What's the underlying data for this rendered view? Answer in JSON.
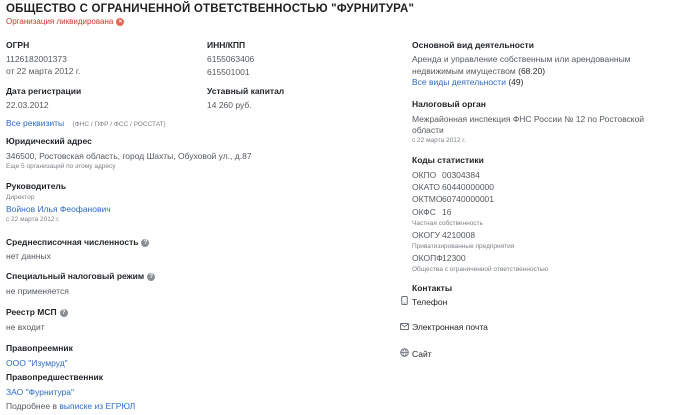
{
  "header": {
    "company_title": "ОБЩЕСТВО С ОГРАНИЧЕННОЙ ОТВЕТСТВЕННОСТЬЮ \"ФУРНИТУРА\"",
    "status_text": "Организация ликвидирована",
    "status_icon": "close-circle-icon"
  },
  "ogrn": {
    "label": "ОГРН",
    "value": "1126182001373",
    "date": "от 22 марта 2012 г."
  },
  "inn_kpp": {
    "label": "ИНН/КПП",
    "inn": "6155063406",
    "kpp": "615501001"
  },
  "registration": {
    "label": "Дата регистрации",
    "value": "22.03.2012"
  },
  "capital": {
    "label": "Уставный капитал",
    "value": "14 260 руб."
  },
  "requisites": {
    "link": "Все реквизиты",
    "sources": "(ФНС / ПФР / ФСС / РОССТАТ)"
  },
  "address": {
    "label": "Юридический адрес",
    "value": "346500, Ростовская область, город Шахты, Обуховой ул., д.87",
    "note": "Еще 5 организаций по этому адресу"
  },
  "director": {
    "label": "Руководитель",
    "role": "Директор",
    "name": "Войнов Илья Феофанович",
    "date": "с 22 марта 2012 г."
  },
  "headcount": {
    "label": "Среднесписочная численность",
    "value": "нет данных"
  },
  "tax_regime": {
    "label": "Специальный налоговый режим",
    "value": "не применяется"
  },
  "msp": {
    "label": "Реестр МСП",
    "value": "не входит"
  },
  "successor": {
    "label": "Правопреемник",
    "value": "ООО \"Изумруд\""
  },
  "predecessor": {
    "label": "Правопредшественник",
    "value": "ЗАО \"Фурнитура\"",
    "more_prefix": "Подробнее в",
    "more_link": "выписке из ЕГРЮЛ"
  },
  "activity": {
    "label": "Основной вид деятельности",
    "line1": "Аренда и управление собственным или арендованным",
    "line2_text": "недвижимым имуществом",
    "line2_code": "(68.20)",
    "all_link": "Все виды деятельности",
    "all_count": "(49)"
  },
  "tax_authority": {
    "label": "Налоговый орган",
    "line1": "Межрайонная инспекция ФНС России № 12 по Ростовской",
    "line2": "области",
    "date": "с 22 марта 2012 г."
  },
  "stat_codes": {
    "label": "Коды статистики",
    "okpo_k": "ОКПО",
    "okpo_v": "00304384",
    "okato_k": "ОКАТО",
    "okato_v": "60440000000",
    "oktmo_k": "ОКТМО",
    "oktmo_v": "60740000001",
    "okfs_k": "ОКФС",
    "okfs_v": "16",
    "okfs_note": "Частная собственность",
    "okogu_k": "ОКОГУ",
    "okogu_v": "4210008",
    "okogu_note": "Приватизированные предприятия",
    "okopf_k": "ОКОПФ",
    "okopf_v": "12300",
    "okopf_note": "Общества с ограниченной ответственностью"
  },
  "contacts": {
    "label": "Контакты",
    "phone": "Телефон",
    "email": "Электронная почта",
    "site": "Сайт"
  },
  "icons": {
    "help": "question-circle-icon",
    "phone": "phone-icon",
    "email": "envelope-icon",
    "site": "globe-icon"
  }
}
